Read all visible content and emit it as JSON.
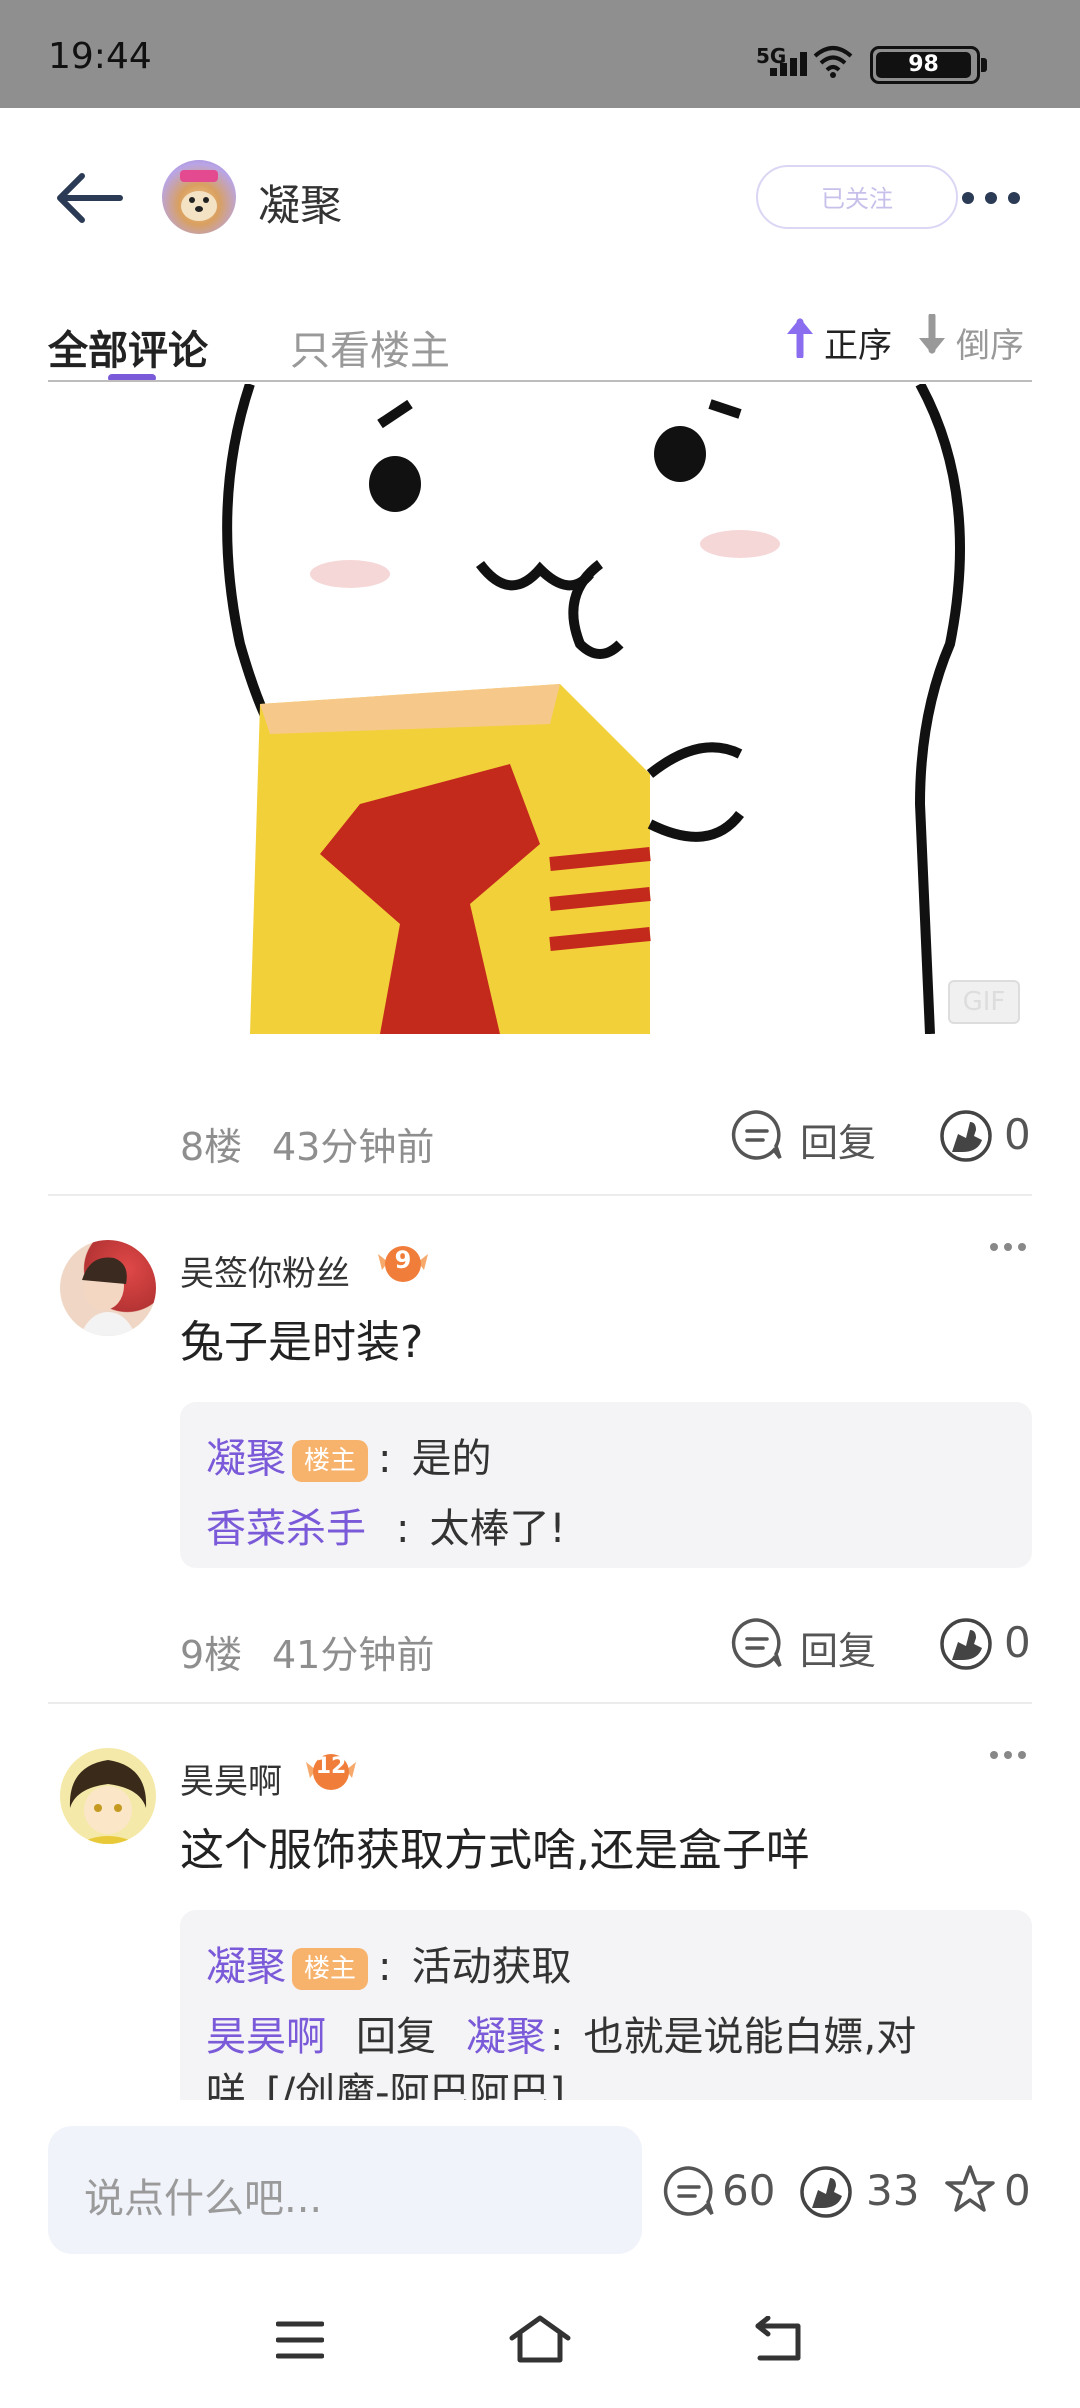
{
  "status_bar": {
    "time": "19:44",
    "network": "5G",
    "battery": "98"
  },
  "header": {
    "title": "凝聚",
    "follow_label": "已关注"
  },
  "tabs": {
    "all": "全部评论",
    "owner_only": "只看楼主",
    "sort_asc": "正序",
    "sort_desc": "倒序"
  },
  "gif_label": "GIF",
  "post": {
    "floor": "8楼",
    "time": "43分钟前",
    "reply_label": "回复",
    "likes": "0"
  },
  "comments": [
    {
      "user": "吴签你粉丝",
      "level": "9",
      "text": "兔子是时装?",
      "replies": [
        {
          "name": "凝聚",
          "tag": "楼主",
          "sep": ":",
          "text": "是的"
        },
        {
          "name": "香菜杀手",
          "sep": ":",
          "text": "太棒了!"
        }
      ],
      "floor": "9楼",
      "time": "41分钟前",
      "reply_label": "回复",
      "likes": "0"
    },
    {
      "user": "昊昊啊",
      "level": "12",
      "text": "这个服饰获取方式啥,还是盒子咩",
      "replies": [
        {
          "name": "凝聚",
          "tag": "楼主",
          "sep": ":",
          "text": "活动获取"
        },
        {
          "name": "昊昊啊",
          "verb": "回复",
          "target": "凝聚",
          "sep": ":",
          "text": "也就是说能白嫖,对",
          "text2": "咩_[/创魔-阿巴阿巴]"
        }
      ]
    }
  ],
  "bottom_bar": {
    "placeholder": "说点什么吧...",
    "comments": "60",
    "likes": "33",
    "stars": "0"
  }
}
